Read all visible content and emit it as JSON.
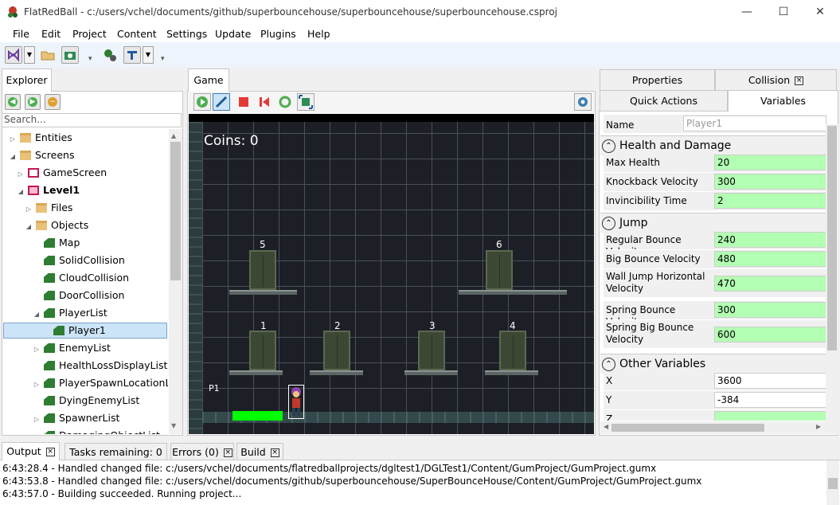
{
  "window": {
    "title": "FlatRedBall - c:/users/vchel/documents/github/superbouncehouse/superbouncehouse/superbouncehouse.csproj",
    "minimize": "—",
    "maximize": "☐",
    "close": "✕"
  },
  "menu": [
    "File",
    "Edit",
    "Project",
    "Content",
    "Settings",
    "Update",
    "Plugins",
    "Help"
  ],
  "explorer": {
    "tab": "Explorer",
    "search_placeholder": "Search...",
    "tree": [
      {
        "label": "Entities",
        "icon": "folder-icon",
        "expander": "▷",
        "bold": false,
        "selected": false
      },
      {
        "label": "Screens",
        "icon": "folder-icon",
        "expander": "◢",
        "bold": false,
        "selected": false
      },
      {
        "label": "GameScreen",
        "icon": "screen-icon",
        "expander": "▷",
        "bold": false,
        "selected": false
      },
      {
        "label": "Level1",
        "icon": "screen-start-icon",
        "expander": "◢",
        "bold": true,
        "selected": false
      },
      {
        "label": "Files",
        "icon": "folder-icon",
        "expander": "▷",
        "bold": false,
        "selected": false
      },
      {
        "label": "Objects",
        "icon": "folder-icon",
        "expander": "◢",
        "bold": false,
        "selected": false
      },
      {
        "label": "Map",
        "icon": "object-icon",
        "expander": "",
        "bold": false,
        "selected": false
      },
      {
        "label": "SolidCollision",
        "icon": "object-icon",
        "expander": "",
        "bold": false,
        "selected": false
      },
      {
        "label": "CloudCollision",
        "icon": "object-icon",
        "expander": "",
        "bold": false,
        "selected": false
      },
      {
        "label": "DoorCollision",
        "icon": "object-icon",
        "expander": "",
        "bold": false,
        "selected": false
      },
      {
        "label": "PlayerList",
        "icon": "object-icon",
        "expander": "◢",
        "bold": false,
        "selected": false
      },
      {
        "label": "Player1",
        "icon": "object-icon",
        "expander": "",
        "bold": false,
        "selected": true
      },
      {
        "label": "EnemyList",
        "icon": "object-icon",
        "expander": "▷",
        "bold": false,
        "selected": false
      },
      {
        "label": "HealthLossDisplayList",
        "icon": "object-icon",
        "expander": "",
        "bold": false,
        "selected": false
      },
      {
        "label": "PlayerSpawnLocationList",
        "icon": "object-icon",
        "expander": "▷",
        "bold": false,
        "selected": false
      },
      {
        "label": "DyingEnemyList",
        "icon": "object-icon",
        "expander": "",
        "bold": false,
        "selected": false
      },
      {
        "label": "SpawnerList",
        "icon": "object-icon",
        "expander": "▷",
        "bold": false,
        "selected": false
      },
      {
        "label": "DamagingObjectList",
        "icon": "object-icon",
        "expander": "",
        "bold": false,
        "selected": false
      }
    ]
  },
  "game": {
    "tab": "Game",
    "coins_text": "Coins: 0",
    "player_label": "P1",
    "door_labels": [
      "5",
      "6",
      "1",
      "2",
      "3",
      "4"
    ]
  },
  "properties": {
    "tabs": {
      "properties": "Properties",
      "collision": "Collision",
      "quick_actions": "Quick Actions",
      "variables": "Variables"
    },
    "name_label": "Name",
    "name_value": "Player1",
    "categories": [
      {
        "title": "Health and Damage",
        "rows": [
          {
            "label": "Max Health",
            "value": "20"
          },
          {
            "label": "Knockback Velocity",
            "value": "300"
          },
          {
            "label": "Invincibility Time",
            "value": "2"
          }
        ]
      },
      {
        "title": "Jump",
        "rows": [
          {
            "label": "Regular Bounce Velocity",
            "value": "240"
          },
          {
            "label": "Big Bounce Velocity",
            "value": "480"
          },
          {
            "label": "Wall Jump Horizontal Velocity",
            "value": "470"
          },
          {
            "label": "Spring Bounce Velocity",
            "value": "300"
          },
          {
            "label": "Spring Big Bounce Velocity",
            "value": "600"
          }
        ]
      },
      {
        "title": "Other Variables",
        "rows": [
          {
            "label": "X",
            "value": "3600"
          },
          {
            "label": "Y",
            "value": "-384"
          },
          {
            "label": "Z",
            "value": ""
          }
        ]
      }
    ]
  },
  "bottom_tabs": {
    "output": "Output",
    "tasks": "Tasks remaining: 0",
    "errors": "Errors (0)",
    "build": "Build"
  },
  "output_lines": [
    "6:43:28.4 - Handled changed file: c:/users/vchel/documents/flatredballprojects/dgltest1/DGLTest1/Content/GumProject/GumProject.gumx",
    "6:43:53.8 - Handled changed file: c:/users/vchel/documents/github/superbouncehouse/SuperBounceHouse/Content/GumProject/GumProject.gumx",
    "6:43:57.0 - Building succeeded. Running project..."
  ],
  "colors": {
    "accent_green": "#b3ffb3",
    "health_bar": "#00ff00",
    "selection": "#cce4f7"
  }
}
